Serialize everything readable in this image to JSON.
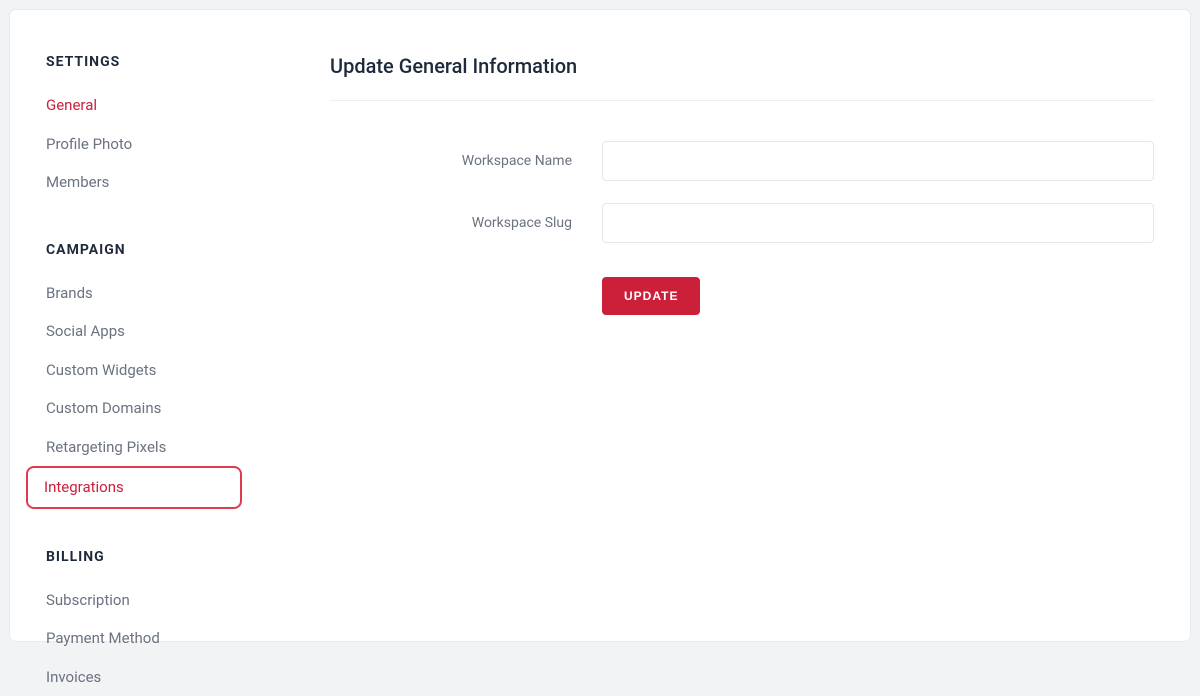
{
  "sidebar": {
    "groups": [
      {
        "title": "SETTINGS",
        "items": [
          {
            "label": "General",
            "name": "nav-item-general",
            "active": true
          },
          {
            "label": "Profile Photo",
            "name": "nav-item-profile-photo"
          },
          {
            "label": "Members",
            "name": "nav-item-members"
          }
        ]
      },
      {
        "title": "CAMPAIGN",
        "items": [
          {
            "label": "Brands",
            "name": "nav-item-brands"
          },
          {
            "label": "Social Apps",
            "name": "nav-item-social-apps"
          },
          {
            "label": "Custom Widgets",
            "name": "nav-item-custom-widgets"
          },
          {
            "label": "Custom Domains",
            "name": "nav-item-custom-domains"
          },
          {
            "label": "Retargeting Pixels",
            "name": "nav-item-retargeting-pixels"
          },
          {
            "label": "Integrations",
            "name": "nav-item-integrations",
            "highlighted": true
          }
        ]
      },
      {
        "title": "BILLING",
        "items": [
          {
            "label": "Subscription",
            "name": "nav-item-subscription"
          },
          {
            "label": "Payment Method",
            "name": "nav-item-payment-method"
          },
          {
            "label": "Invoices",
            "name": "nav-item-invoices"
          }
        ]
      }
    ]
  },
  "main": {
    "title": "Update General Information",
    "fields": {
      "workspace_name": {
        "label": "Workspace Name",
        "value": ""
      },
      "workspace_slug": {
        "label": "Workspace Slug",
        "value": ""
      }
    },
    "update_label": "UPDATE"
  },
  "colors": {
    "accent": "#cc1f3a"
  }
}
